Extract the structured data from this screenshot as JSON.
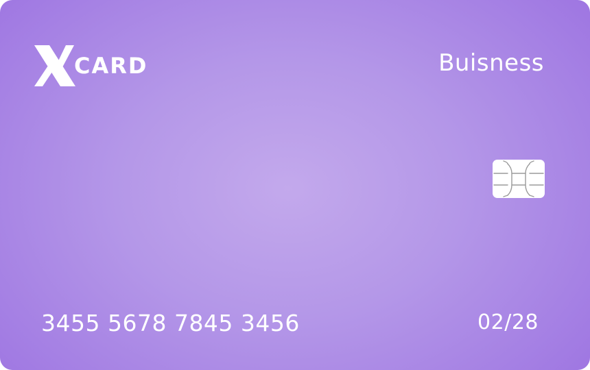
{
  "card": {
    "brand": {
      "logo_text": "CARD",
      "logo_icon": "x-logo-icon"
    },
    "card_type": "Buisness",
    "chip_icon": "chip-icon",
    "number": "3455 5678 7845 3456",
    "expiry": "02/28",
    "colors": {
      "gradient_center": "#c3a9ec",
      "gradient_edge": "#9f77e2",
      "text": "#ffffff"
    }
  }
}
